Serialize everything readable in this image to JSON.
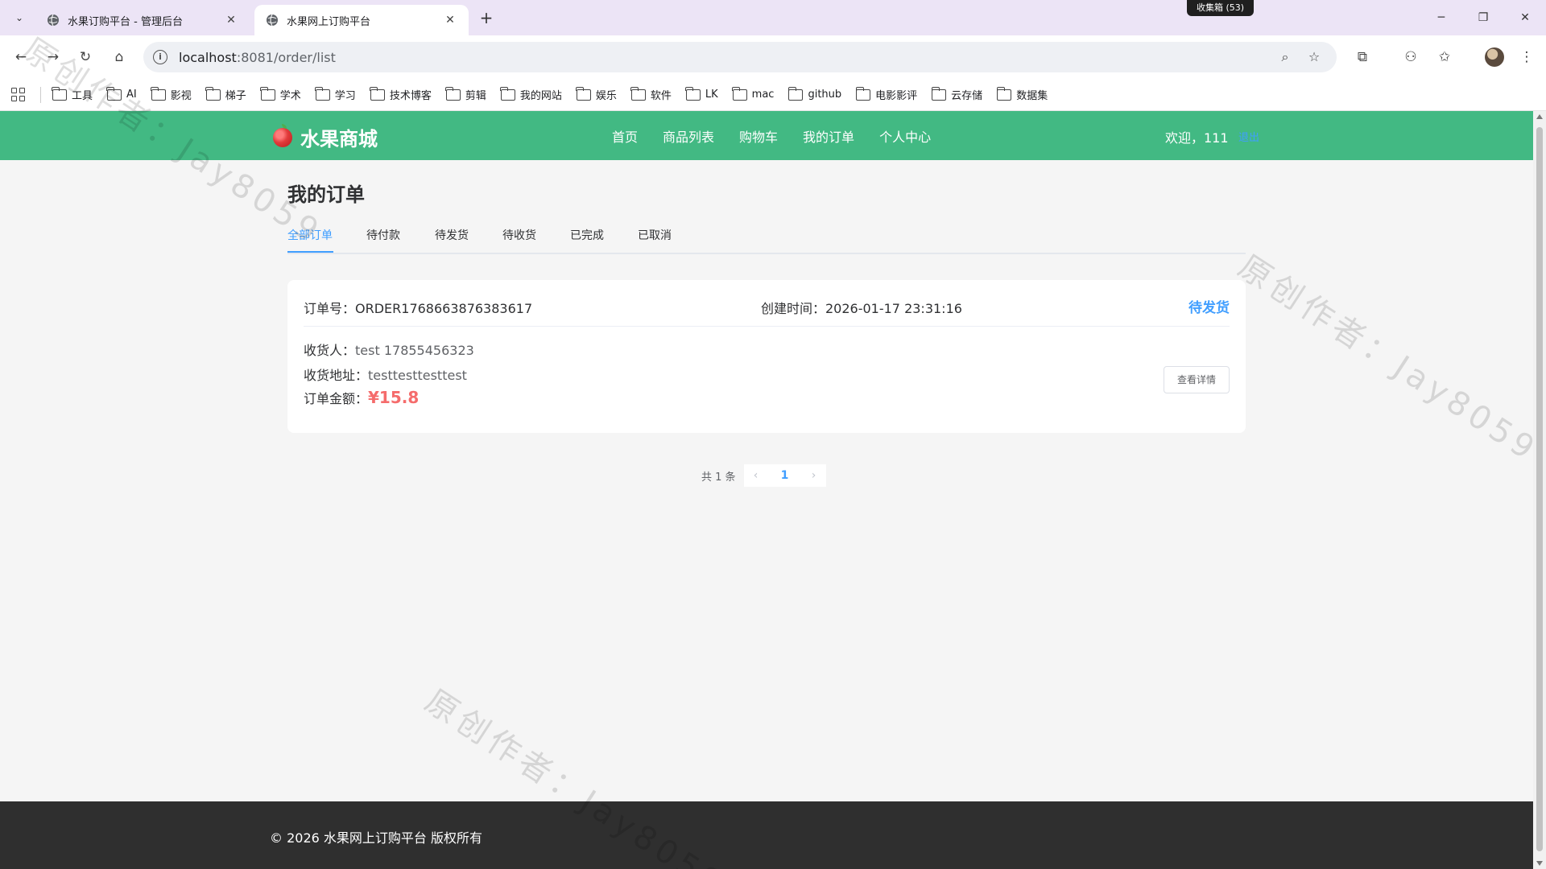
{
  "browser": {
    "tabs": [
      {
        "title": "水果订购平台 - 管理后台",
        "active": false
      },
      {
        "title": "水果网上订购平台",
        "active": true
      }
    ],
    "new_tab": "+",
    "collect_badge": "收集箱 (53)",
    "url_host": "localhost",
    "url_path": ":8081/order/list",
    "bookmarks": [
      "工具",
      "AI",
      "影视",
      "梯子",
      "学术",
      "学习",
      "技术博客",
      "剪辑",
      "我的网站",
      "娱乐",
      "软件",
      "LK",
      "mac",
      "github",
      "电影影评",
      "云存储",
      "数据集"
    ]
  },
  "site": {
    "logo_text": "水果商城",
    "nav": [
      "首页",
      "商品列表",
      "购物车",
      "我的订单",
      "个人中心"
    ],
    "welcome": "欢迎，111",
    "logout": "退出",
    "accent_color": "#42b983"
  },
  "page": {
    "title": "我的订单",
    "tabs": [
      "全部订单",
      "待付款",
      "待发货",
      "待收货",
      "已完成",
      "已取消"
    ],
    "active_tab": "全部订单"
  },
  "orders": [
    {
      "order_no": "订单号：ORDER1768663876383617",
      "created": "创建时间：2026-01-17 23:31:16",
      "status": "待发货",
      "receiver_label": "收货人：",
      "receiver": "test 17855456323",
      "address_label": "收货地址：",
      "address": "testtesttesttest",
      "amount_label": "订单金额：",
      "amount": "¥15.8",
      "detail_button": "查看详情"
    }
  ],
  "pagination": {
    "total": "共 1 条",
    "prev": "‹",
    "current": "1",
    "next": "›"
  },
  "footer": {
    "copyright": "© 2026 水果网上订购平台 版权所有"
  },
  "watermark": "原创作者：Jay8059"
}
